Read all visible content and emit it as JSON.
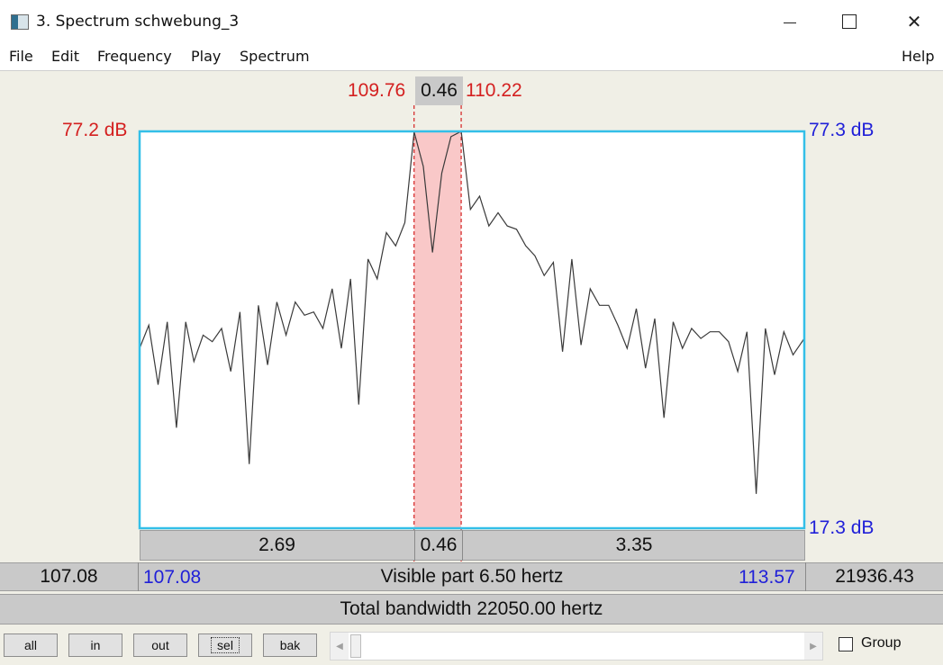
{
  "window": {
    "title": "3. Spectrum schwebung_3",
    "minimize_glyph": "",
    "close_glyph": "✕"
  },
  "menu": {
    "file": "File",
    "edit": "Edit",
    "frequency": "Frequency",
    "play": "Play",
    "spectrum": "Spectrum",
    "help": "Help"
  },
  "selection": {
    "start": "109.76",
    "width": "0.46",
    "end": "110.22"
  },
  "db": {
    "top_left": "77.2 dB",
    "top_right": "77.3 dB",
    "bottom_right": "17.3 dB"
  },
  "intervals": {
    "left": "2.69",
    "middle": "0.46",
    "right": "3.35"
  },
  "range_bar": {
    "outer_left": "107.08",
    "visible_left": "107.08",
    "visible_text": "Visible part 6.50 hertz",
    "visible_right": "113.57",
    "outer_right": "21936.43"
  },
  "total_bar": {
    "text": "Total bandwidth 22050.00 hertz"
  },
  "buttons": {
    "all": "all",
    "in": "in",
    "out": "out",
    "sel": "sel",
    "bak": "bak"
  },
  "group": {
    "label": "Group",
    "checked": false
  },
  "colors": {
    "selection_fill": "#f9c8c8",
    "frame": "#33bfe8",
    "red_text": "#d42020",
    "blue_text": "#2020d8"
  },
  "chart_data": {
    "type": "line",
    "xlim": [
      107.08,
      113.57
    ],
    "ylim": [
      17.3,
      77.3
    ],
    "unit_x": "hertz",
    "unit_y": "dB",
    "x": [
      107.08,
      107.17,
      107.26,
      107.35,
      107.44,
      107.53,
      107.61,
      107.7,
      107.79,
      107.88,
      107.97,
      108.06,
      108.15,
      108.24,
      108.33,
      108.42,
      108.51,
      108.6,
      108.69,
      108.78,
      108.87,
      108.96,
      109.05,
      109.14,
      109.22,
      109.31,
      109.4,
      109.49,
      109.58,
      109.67,
      109.76,
      109.85,
      109.94,
      110.03,
      110.12,
      110.22,
      110.31,
      110.4,
      110.49,
      110.58,
      110.67,
      110.76,
      110.85,
      110.94,
      111.03,
      111.12,
      111.21,
      111.3,
      111.39,
      111.48,
      111.57,
      111.66,
      111.75,
      111.84,
      111.93,
      112.02,
      112.11,
      112.2,
      112.29,
      112.38,
      112.47,
      112.56,
      112.65,
      112.74,
      112.83,
      112.92,
      113.01,
      113.1,
      113.19,
      113.28,
      113.37,
      113.46,
      113.57
    ],
    "y": [
      44.5,
      48.0,
      39.0,
      48.5,
      32.5,
      48.5,
      42.5,
      46.5,
      45.5,
      47.5,
      41.0,
      50.0,
      27.0,
      51.0,
      42.0,
      51.5,
      46.5,
      51.5,
      49.5,
      50.0,
      47.5,
      53.5,
      44.5,
      55.0,
      36.0,
      58.0,
      55.0,
      62.0,
      60.0,
      63.5,
      77.2,
      72.0,
      59.0,
      71.0,
      76.5,
      77.3,
      65.5,
      67.5,
      63.0,
      65.0,
      63.0,
      62.5,
      60.0,
      58.5,
      55.5,
      57.5,
      44.0,
      58.0,
      45.0,
      53.5,
      51.0,
      51.0,
      48.0,
      44.5,
      50.5,
      41.5,
      49.0,
      34.0,
      48.5,
      44.5,
      47.5,
      46.0,
      47.0,
      47.0,
      45.5,
      41.0,
      47.0,
      22.5,
      47.5,
      40.5,
      47.0,
      43.5,
      46.0
    ]
  }
}
